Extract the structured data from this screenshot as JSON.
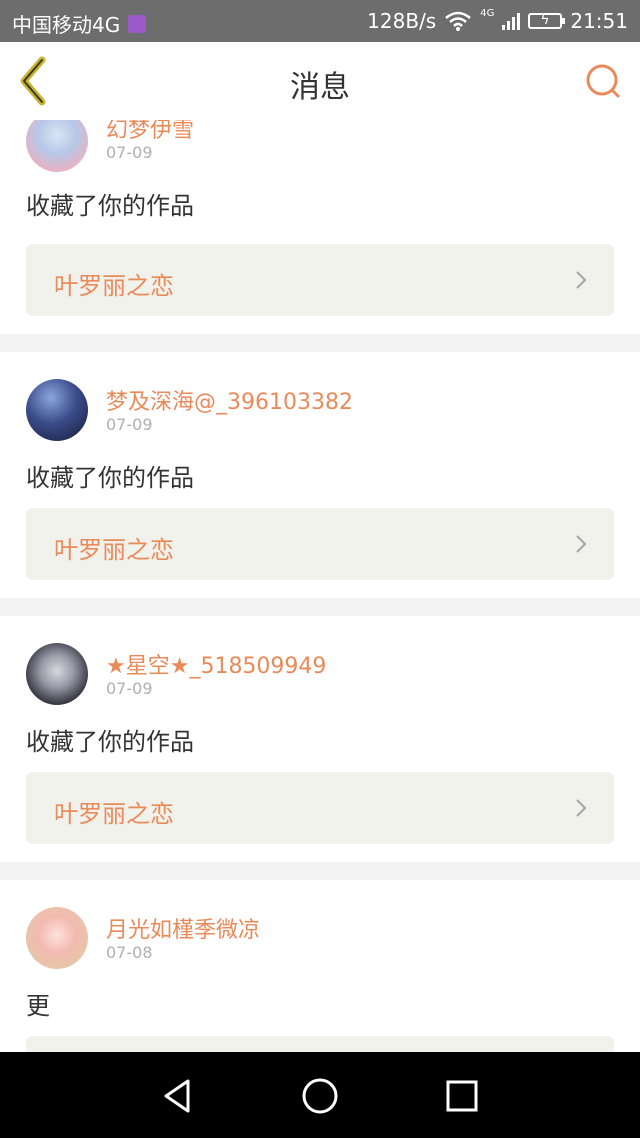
{
  "status_bar": {
    "carrier": "中国移动4G",
    "network_speed": "128B/s",
    "network_type": "4G",
    "time": "21:51"
  },
  "header": {
    "title": "消息",
    "back_icon": "chevron-left-icon",
    "search_icon": "search-icon"
  },
  "colors": {
    "accent": "#e98a5a",
    "back_icon": "#c8b235",
    "status_bar_bg": "#6d6d6d",
    "work_bg": "#f2f2ec"
  },
  "notifications": [
    {
      "username": "幻梦伊雪",
      "date": "07-09",
      "action": "收藏了你的作品",
      "work_title": "叶罗丽之恋"
    },
    {
      "username": "梦及深海@_396103382",
      "date": "07-09",
      "action": "收藏了你的作品",
      "work_title": "叶罗丽之恋"
    },
    {
      "username": "★星空★_518509949",
      "date": "07-09",
      "action": "收藏了你的作品",
      "work_title": "叶罗丽之恋"
    },
    {
      "username": "月光如槿季微凉",
      "date": "07-08",
      "action": "更",
      "work_title": ""
    }
  ],
  "nav_bar": {
    "back": "triangle-back-icon",
    "home": "circle-home-icon",
    "recents": "square-recents-icon"
  }
}
